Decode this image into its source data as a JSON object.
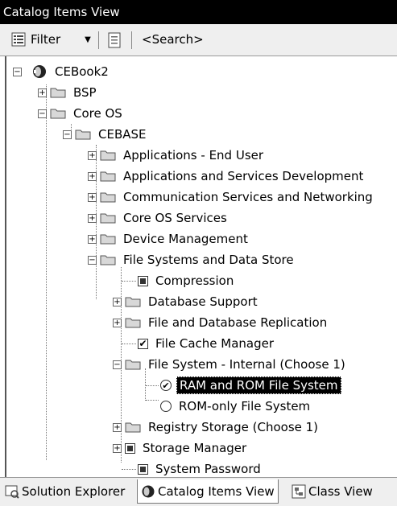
{
  "window": {
    "title": "Catalog Items View"
  },
  "toolbar": {
    "filter_label": "Filter",
    "search_placeholder": "<Search>"
  },
  "tree": {
    "root": "CEBook2",
    "bsp": "BSP",
    "core_os": "Core OS",
    "cebase": "CEBASE",
    "cebase_children": [
      "Applications - End User",
      "Applications and Services Development",
      "Communication Services and Networking",
      "Core OS Services",
      "Device Management",
      "File Systems and Data Store"
    ],
    "fs_children": [
      "Compression",
      "Database Support",
      "File and Database Replication",
      "File Cache Manager",
      "File System - Internal (Choose 1)",
      "Registry Storage (Choose 1)",
      "Storage Manager",
      "System Password"
    ],
    "fs_internal_children": [
      "RAM and ROM File System",
      "ROM-only File System"
    ]
  },
  "tabs": [
    {
      "label": "Solution Explorer",
      "icon": "solution-explorer-icon"
    },
    {
      "label": "Catalog Items View",
      "icon": "catalog-icon"
    },
    {
      "label": "Class View",
      "icon": "class-view-icon"
    }
  ],
  "colors": {
    "title_bg": "#000000",
    "selection_bg": "#000000",
    "toolbar_bg": "#efefef"
  }
}
